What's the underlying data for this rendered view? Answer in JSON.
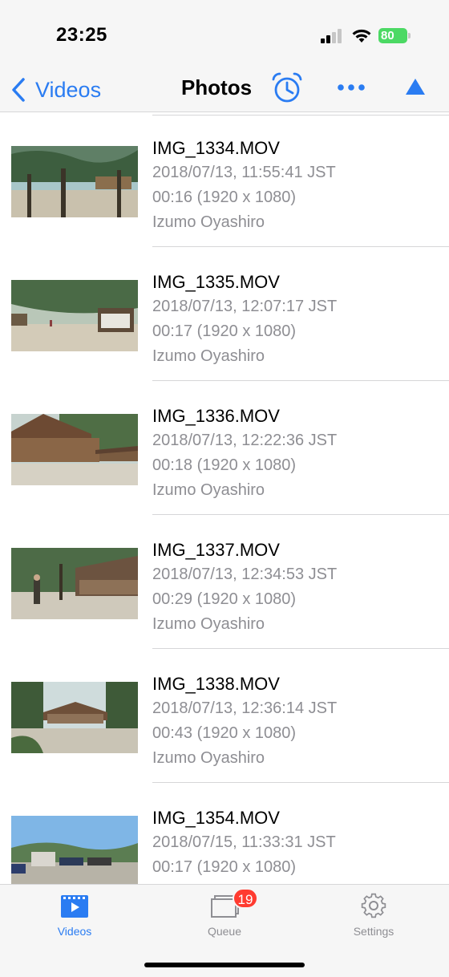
{
  "status": {
    "time": "23:25",
    "battery": "80"
  },
  "nav": {
    "back_label": "Videos",
    "title": "Photos"
  },
  "items": [
    {
      "filename": "IMG_1334.MOV",
      "datetime": "2018/07/13, 11:55:41 JST",
      "duration": "00:16 (1920 x 1080)",
      "location": "Izumo Oyashiro"
    },
    {
      "filename": "IMG_1335.MOV",
      "datetime": "2018/07/13, 12:07:17 JST",
      "duration": "00:17 (1920 x 1080)",
      "location": "Izumo Oyashiro"
    },
    {
      "filename": "IMG_1336.MOV",
      "datetime": "2018/07/13, 12:22:36 JST",
      "duration": "00:18 (1920 x 1080)",
      "location": "Izumo Oyashiro"
    },
    {
      "filename": "IMG_1337.MOV",
      "datetime": "2018/07/13, 12:34:53 JST",
      "duration": "00:29 (1920 x 1080)",
      "location": "Izumo Oyashiro"
    },
    {
      "filename": "IMG_1338.MOV",
      "datetime": "2018/07/13, 12:36:14 JST",
      "duration": "00:43 (1920 x 1080)",
      "location": "Izumo Oyashiro"
    },
    {
      "filename": "IMG_1354.MOV",
      "datetime": "2018/07/15, 11:33:31 JST",
      "duration": "00:17 (1920 x 1080)",
      "location": ""
    }
  ],
  "tabs": [
    {
      "label": "Videos",
      "icon": "video-play-icon",
      "active": true
    },
    {
      "label": "Queue",
      "icon": "queue-icon",
      "badge": "19"
    },
    {
      "label": "Settings",
      "icon": "gear-icon"
    }
  ],
  "colors": {
    "accent": "#2a7cf2",
    "badge": "#ff3b30",
    "battery": "#4cd964",
    "secondary_text": "#8e8e93"
  }
}
